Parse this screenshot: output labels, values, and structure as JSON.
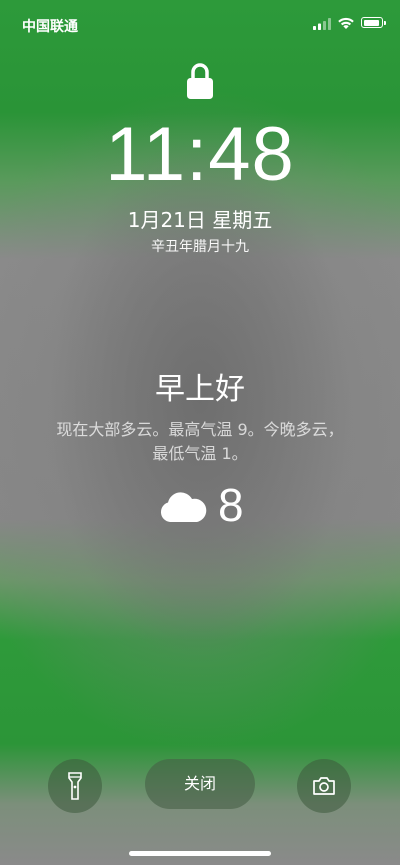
{
  "status_bar": {
    "carrier": "中国联通"
  },
  "lock_screen": {
    "time": "11:48",
    "date": "1月21日 星期五",
    "lunar_date": "辛丑年腊月十九",
    "greeting": "早上好",
    "weather_description": "现在大部多云。最高气温 9。今晚多云，最低气温 1。",
    "temperature": "8",
    "weather_icon": "cloud-icon"
  },
  "controls": {
    "close_label": "关闭"
  },
  "colors": {
    "green": "#2d9a3a",
    "gray": "#888888"
  }
}
